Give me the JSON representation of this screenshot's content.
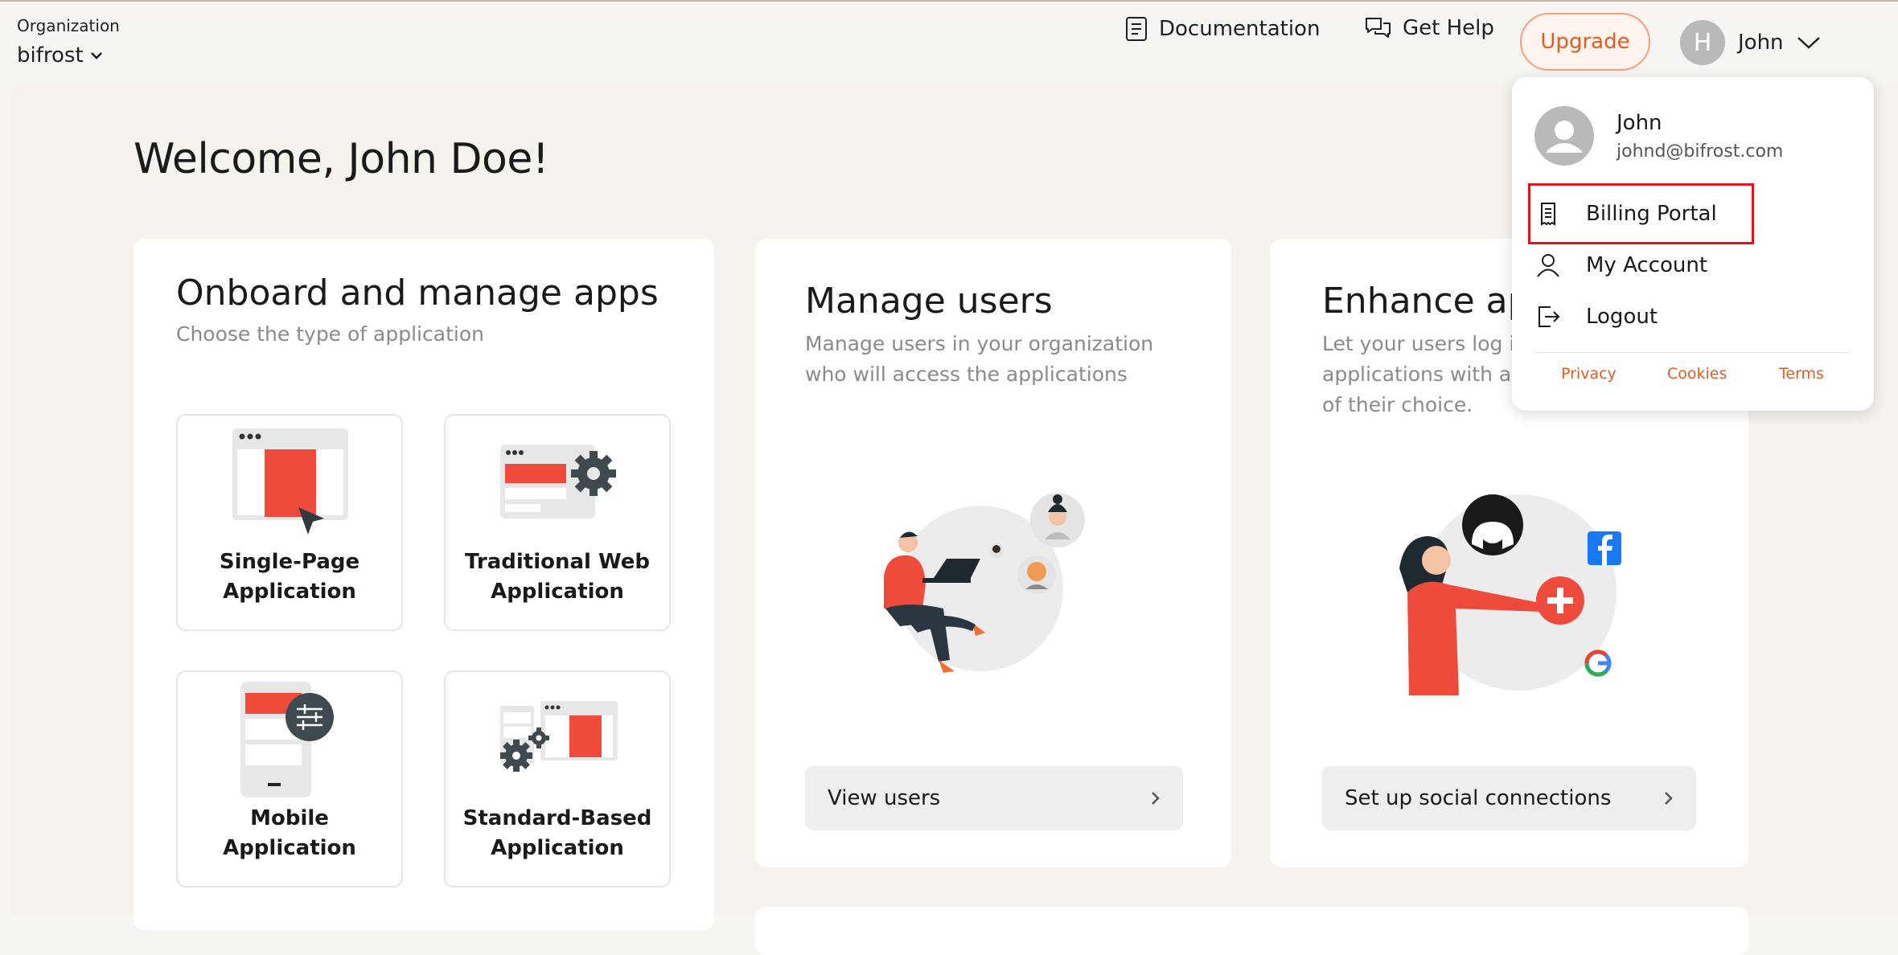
{
  "header": {
    "org_label": "Organization",
    "org_name": "bifrost",
    "documentation": "Documentation",
    "get_help": "Get Help",
    "upgrade": "Upgrade",
    "user_initial": "H",
    "user_name": "John"
  },
  "welcome": "Welcome, John Doe!",
  "onboard": {
    "title": "Onboard and manage apps",
    "subtitle": "Choose the type of application",
    "apps": [
      {
        "line1": "Single-Page",
        "line2": "Application"
      },
      {
        "line1": "Traditional Web",
        "line2": "Application"
      },
      {
        "line1": "Mobile",
        "line2": "Application"
      },
      {
        "line1": "Standard-Based",
        "line2": "Application"
      }
    ]
  },
  "users": {
    "title": "Manage users",
    "subtitle_line1": "Manage users in your organization",
    "subtitle_line2": "who will access the applications",
    "button": "View users"
  },
  "enhance": {
    "title": "Enhance ap",
    "subtitle_line1": "Let your users log in",
    "subtitle_line2": "applications with an",
    "subtitle_line3": "of their choice.",
    "button": "Set up social connections"
  },
  "dropdown": {
    "name": "John",
    "email": "johnd@bifrost.com",
    "items": [
      "Billing Portal",
      "My Account",
      "Logout"
    ],
    "footer": [
      "Privacy",
      "Cookies",
      "Terms"
    ]
  },
  "colors": {
    "accent": "#e35b22",
    "highlight": "#e0141e",
    "illustration_red": "#ef4b3c"
  }
}
